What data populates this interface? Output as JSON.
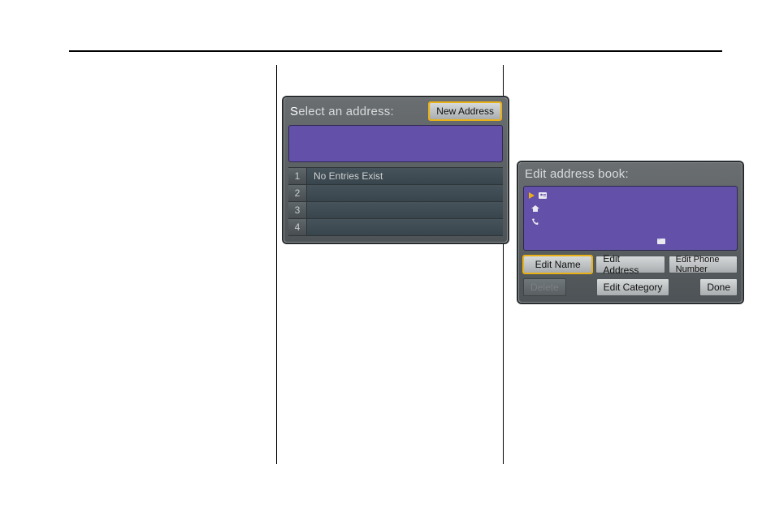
{
  "panel1": {
    "title_prefix": "S",
    "title_rest": "elect an address:",
    "new_address_btn": "New Address",
    "rows": [
      {
        "idx": "1",
        "text": "No Entries Exist"
      },
      {
        "idx": "2",
        "text": ""
      },
      {
        "idx": "3",
        "text": ""
      },
      {
        "idx": "4",
        "text": ""
      }
    ]
  },
  "panel2": {
    "title": "Edit address book:",
    "btn_edit_name": "Edit Name",
    "btn_edit_address": "Edit Address",
    "btn_edit_phone": "Edit Phone Number",
    "btn_delete": "Delete",
    "btn_edit_category": "Edit Category",
    "btn_done": "Done"
  }
}
